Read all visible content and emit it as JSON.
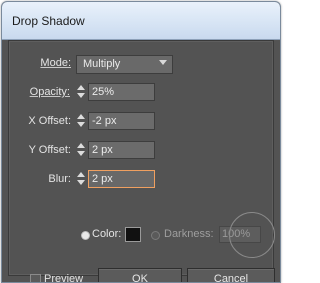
{
  "dialog": {
    "title": "Drop Shadow"
  },
  "fields": {
    "mode_label": "Mode:",
    "mode_value": "Multiply",
    "opacity_label": "Opacity:",
    "opacity_value": "25%",
    "x_offset_label": "X Offset:",
    "x_offset_value": "-2 px",
    "y_offset_label": "Y Offset:",
    "y_offset_value": "2 px",
    "blur_label": "Blur:",
    "blur_value": "2 px"
  },
  "color_options": {
    "color_label": "Color:",
    "color_swatch": "#111111",
    "darkness_label": "Darkness:",
    "darkness_value": "100%"
  },
  "footer": {
    "preview_label": "Preview",
    "ok_label": "OK",
    "cancel_label": "Cancel"
  },
  "colors": {
    "panel": "#535353",
    "title_bar": "#d9e6f5",
    "focus": "#f0a060"
  }
}
